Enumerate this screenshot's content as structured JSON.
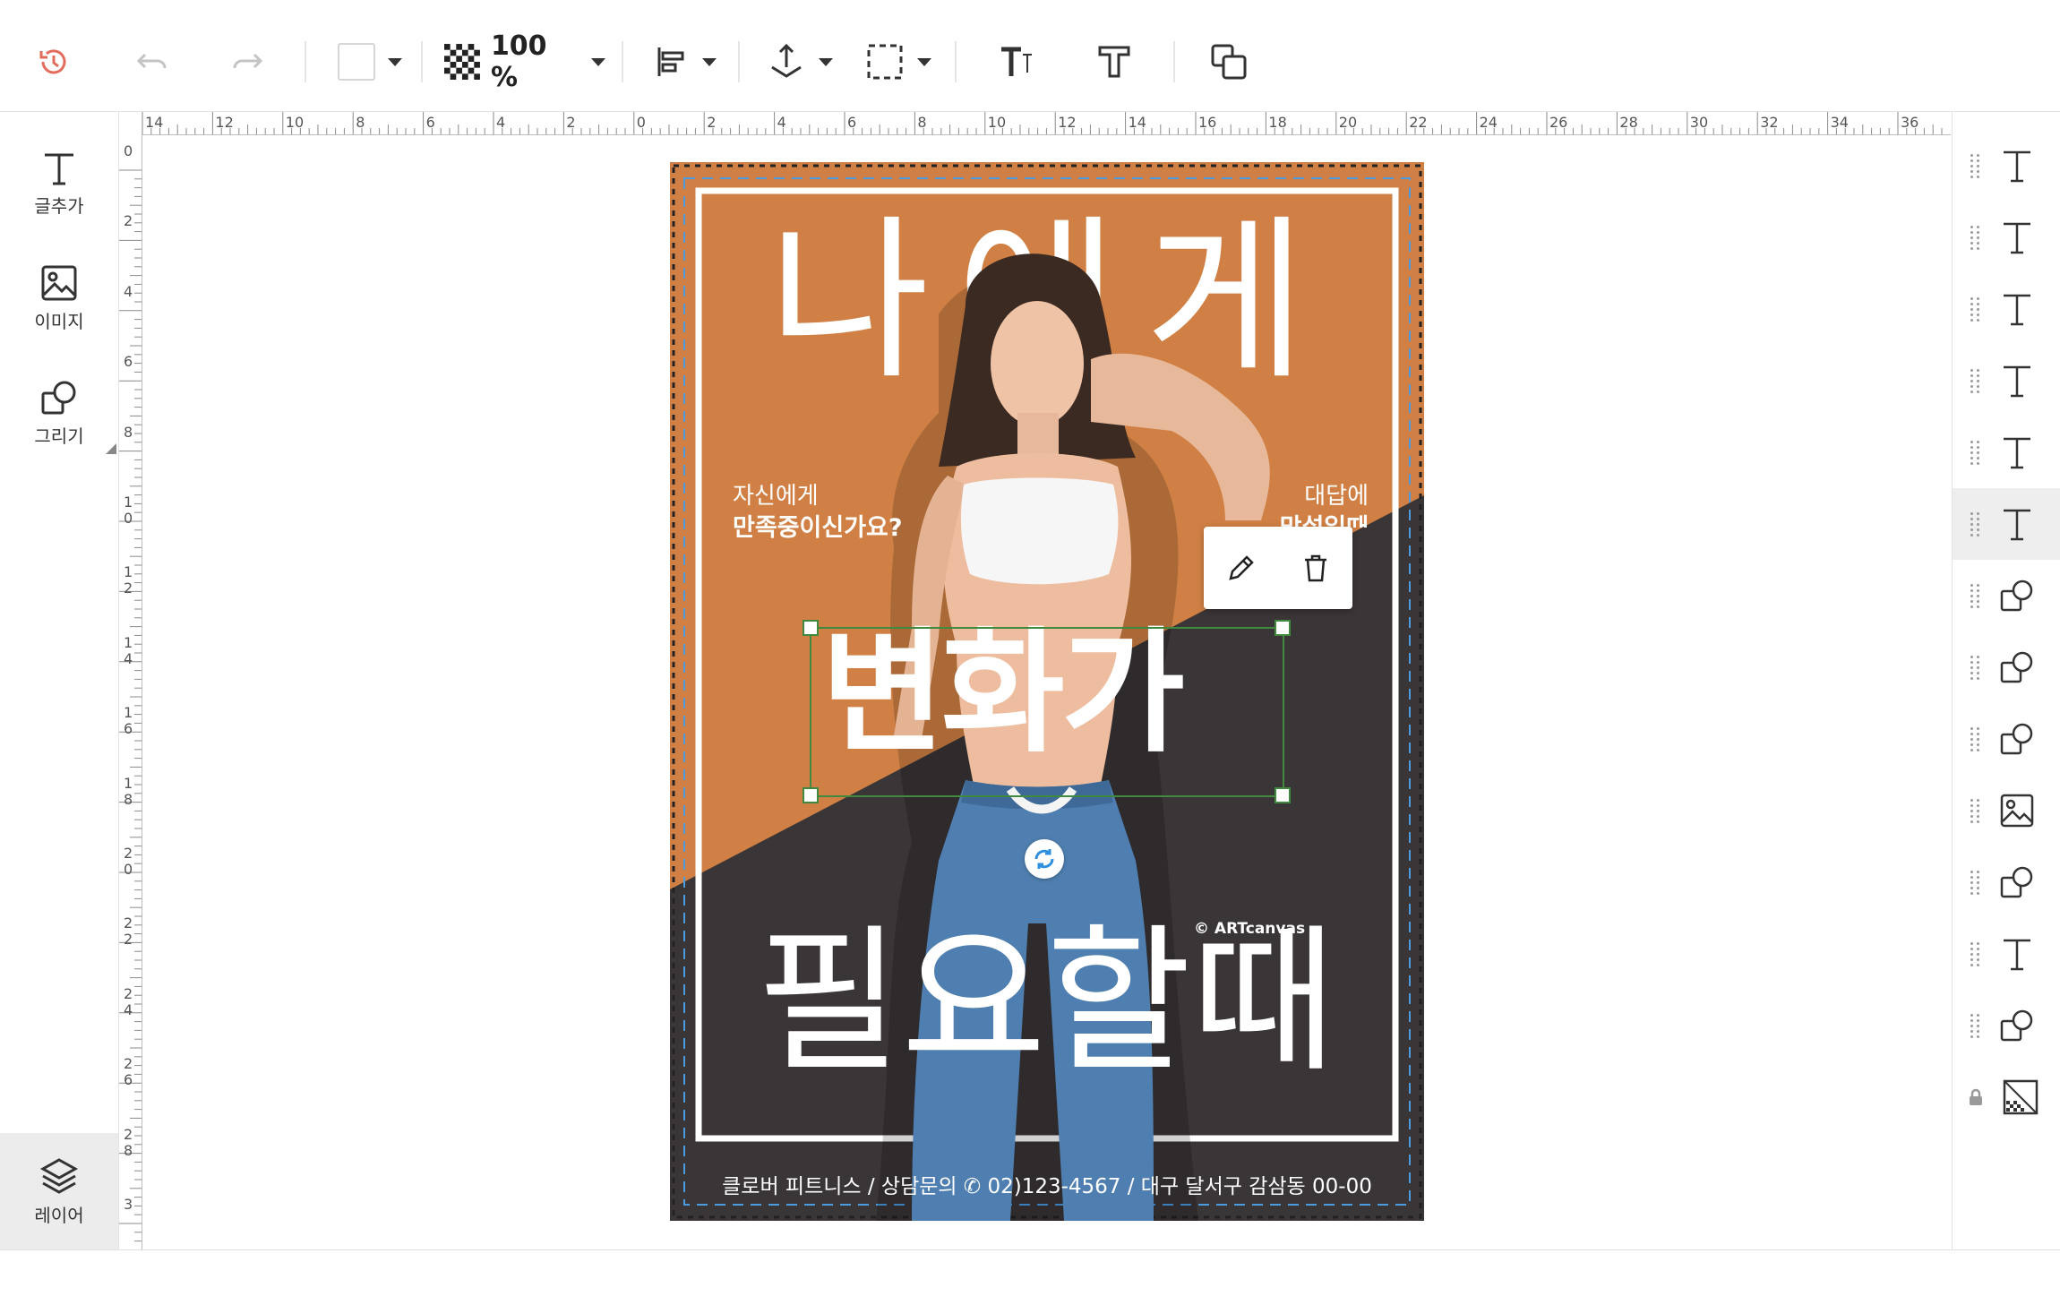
{
  "toolbar": {
    "zoom": "100 %"
  },
  "left_panel": {
    "items": [
      {
        "label": "글추가",
        "icon": "text-icon"
      },
      {
        "label": "이미지",
        "icon": "image-icon"
      },
      {
        "label": "그리기",
        "icon": "shapes-icon"
      }
    ],
    "layer_label": "레이어"
  },
  "rulers": {
    "top": [
      "14",
      "12",
      "10",
      "8",
      "6",
      "4",
      "2",
      "0",
      "2",
      "4",
      "6",
      "8",
      "10",
      "12",
      "14",
      "16",
      "18",
      "20",
      "22",
      "24",
      "26",
      "28",
      "30",
      "32",
      "34",
      "36"
    ],
    "left": [
      "0",
      "2",
      "4",
      "6",
      "8",
      "1\n0",
      "1\n2",
      "1\n4",
      "1\n6",
      "1\n8",
      "2\n0",
      "2\n2",
      "2\n4",
      "2\n6",
      "2\n8",
      "3"
    ]
  },
  "poster": {
    "headline_top": "나에게",
    "left_line1": "자신에게",
    "left_line2": "만족중이신가요?",
    "right_line1": "대답에",
    "right_line2": "망설일때",
    "headline_mid": "변화가",
    "headline_bottom": "필요할때",
    "watermark": "© ARTcanvas",
    "footer": "클로버 피트니스 / 상담문의 ✆ 02)123-4567 / 대구 달서구 감삼동 00-00",
    "colors": {
      "orange": "#d08044",
      "dark": "#3a3536",
      "selection": "#3f8a3f",
      "guide": "#4a9be0"
    }
  },
  "layers": [
    {
      "type": "text",
      "icon": "text-icon"
    },
    {
      "type": "text",
      "icon": "text-icon"
    },
    {
      "type": "text",
      "icon": "text-icon"
    },
    {
      "type": "text",
      "icon": "text-icon"
    },
    {
      "type": "text",
      "icon": "text-icon"
    },
    {
      "type": "text",
      "icon": "text-icon",
      "active": true
    },
    {
      "type": "shape",
      "icon": "shapes-icon"
    },
    {
      "type": "shape",
      "icon": "shapes-icon"
    },
    {
      "type": "shape",
      "icon": "shapes-icon"
    },
    {
      "type": "image",
      "icon": "image-icon"
    },
    {
      "type": "shape",
      "icon": "shapes-icon"
    },
    {
      "type": "text",
      "icon": "text-icon"
    },
    {
      "type": "shape",
      "icon": "shapes-icon"
    },
    {
      "type": "background",
      "icon": "background-icon",
      "locked": true
    }
  ]
}
